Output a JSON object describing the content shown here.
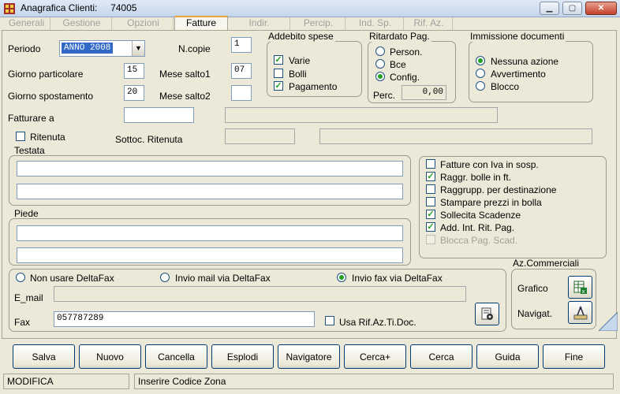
{
  "window": {
    "title": "Anagrafica Clienti:",
    "code": "74005"
  },
  "tabs": [
    "Generali",
    "Gestione",
    "Opzioni",
    "Fatture",
    "Indir.",
    "Percip.",
    "Ind. Sp.",
    "Rif. Az."
  ],
  "active_tab": "Fatture",
  "form": {
    "periodo_label": "Periodo",
    "periodo_value": "ANNO 2008",
    "ncopie_label": "N.copie",
    "ncopie_value": "1",
    "giorno_particolare_label": "Giorno particolare",
    "giorno_particolare_value": "15",
    "mese_salto1_label": "Mese salto1",
    "mese_salto1_value": "07",
    "giorno_spostamento_label": "Giorno spostamento",
    "giorno_spostamento_value": "20",
    "mese_salto2_label": "Mese salto2",
    "mese_salto2_value": "",
    "fatturare_label": "Fatturare a",
    "ritenuta_label": "Ritenuta",
    "sottoc_label": "Sottoc. Ritenuta",
    "testata_label": "Testata",
    "piede_label": "Piede"
  },
  "addebito": {
    "title": "Addebito spese",
    "items": [
      {
        "label": "Varie",
        "checked": true
      },
      {
        "label": "Bolli",
        "checked": false
      },
      {
        "label": "Pagamento",
        "checked": true
      }
    ]
  },
  "ritardato": {
    "title": "Ritardato Pag.",
    "options": [
      "Person.",
      "Bce",
      "Config."
    ],
    "selected": "Config.",
    "perc_label": "Perc.",
    "perc_value": "0,00"
  },
  "immissione": {
    "title": "Immissione documenti",
    "options": [
      "Nessuna azione",
      "Avvertimento",
      "Blocco"
    ],
    "selected": "Nessuna azione"
  },
  "options_list": [
    {
      "label": "Fatture con Iva in sosp.",
      "checked": false,
      "enabled": true
    },
    {
      "label": "Raggr. bolle in ft.",
      "checked": true,
      "enabled": true
    },
    {
      "label": "Raggrupp. per destinazione",
      "checked": false,
      "enabled": true
    },
    {
      "label": "Stampare prezzi in bolla",
      "checked": false,
      "enabled": true
    },
    {
      "label": "Sollecita Scadenze",
      "checked": true,
      "enabled": true
    },
    {
      "label": "Add. Int. Rit. Pag.",
      "checked": true,
      "enabled": true
    },
    {
      "label": "Blocca Pag. Scad.",
      "checked": false,
      "enabled": false
    }
  ],
  "deltafax": {
    "options": [
      "Non usare DeltaFax",
      "Invio mail via DeltaFax",
      "Invio fax via DeltaFax"
    ],
    "selected": "Invio fax via DeltaFax",
    "email_label": "E_mail",
    "email_value": "",
    "fax_label": "Fax",
    "fax_value": "057787289",
    "usa_rif_label": "Usa Rif.Az.Ti.Doc."
  },
  "az_commerciali": {
    "title": "Az.Commerciali",
    "grafico_label": "Grafico",
    "navigat_label": "Navigat."
  },
  "buttons": [
    "Salva",
    "Nuovo",
    "Cancella",
    "Esplodi",
    "Navigatore",
    "Cerca+",
    "Cerca",
    "Guida",
    "Fine"
  ],
  "status": {
    "mode": "MODIFICA",
    "message": "Inserire Codice Zona"
  }
}
